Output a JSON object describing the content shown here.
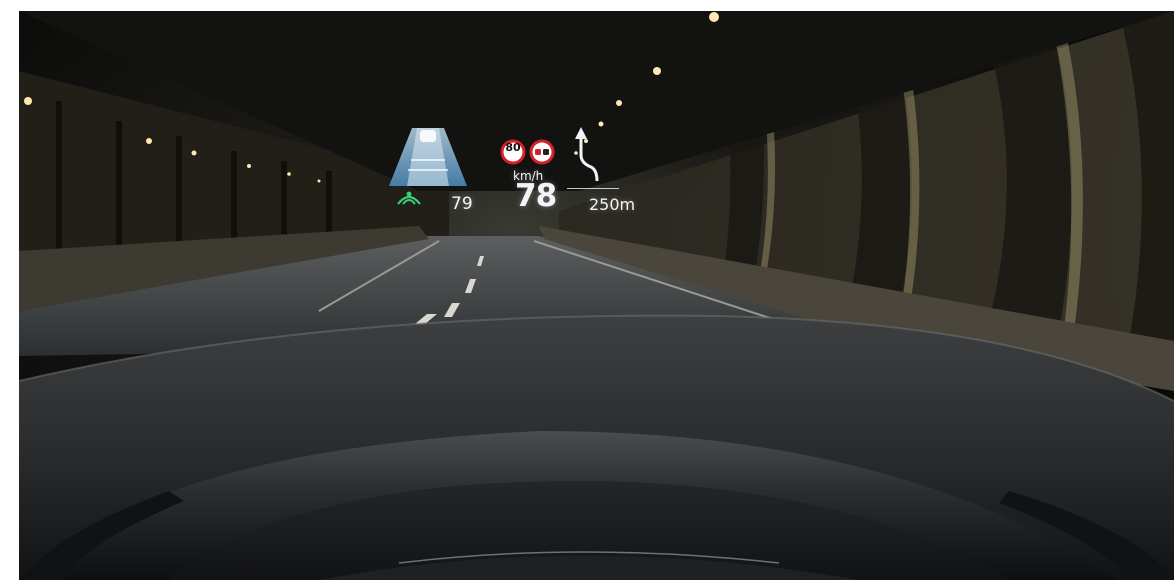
{
  "hud": {
    "speed_sign_limit": "80",
    "acc_set_speed": "79",
    "speed_unit": "km/h",
    "current_speed": "78",
    "nav_distance": "250m",
    "icons": [
      "lane-assist-icon",
      "speed-limit-sign-icon",
      "no-overtaking-sign-icon",
      "turn-arrow-icon",
      "adaptive-cruise-icon"
    ]
  },
  "colors": {
    "hud_text": "#f2f5f8",
    "lane_assist_green": "#39d07a",
    "sign_red": "#d3202b",
    "tunnel_lights": "#ffe8b0"
  }
}
